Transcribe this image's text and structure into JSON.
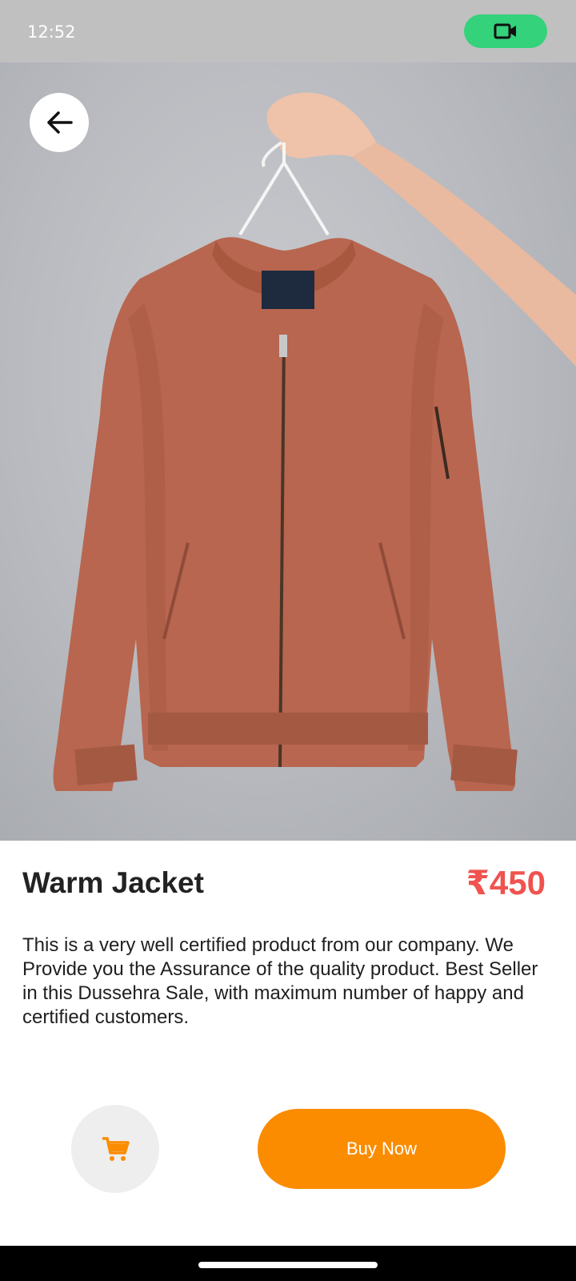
{
  "status_bar": {
    "time": "12:52",
    "video_icon": "video-camera-icon",
    "pill_color": "#34d27a"
  },
  "header": {
    "back_icon": "arrow-left-icon"
  },
  "product": {
    "image_icon": "jacket-on-hanger-image",
    "title": "Warm Jacket",
    "price": "₹450",
    "price_color": "#ef5350",
    "description": "This is a very well certified product from our company. We Provide you the Assurance of the quality product. Best Seller in this Dussehra Sale, with maximum number of happy and certified customers."
  },
  "actions": {
    "cart_icon": "shopping-cart-icon",
    "buy_label": "Buy Now",
    "accent": "#fb8c00"
  }
}
